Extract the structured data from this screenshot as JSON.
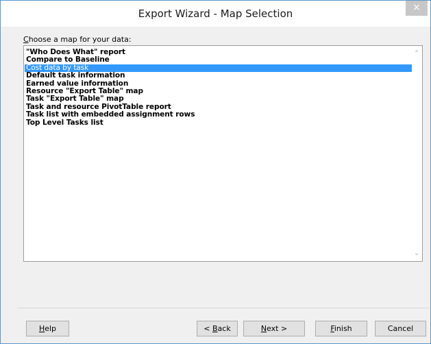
{
  "window": {
    "title": "Export Wizard - Map Selection",
    "close_glyph": "×"
  },
  "prompt": {
    "accesskey": "C",
    "rest": "hoose a map for your data:"
  },
  "maps": [
    {
      "label": "\"Who Does What\" report",
      "selected": false
    },
    {
      "label": "Compare to Baseline",
      "selected": false
    },
    {
      "label": "Cost data by task",
      "selected": true
    },
    {
      "label": "Default task information",
      "selected": false
    },
    {
      "label": "Earned value information",
      "selected": false
    },
    {
      "label": "Resource \"Export Table\" map",
      "selected": false
    },
    {
      "label": "Task \"Export Table\" map",
      "selected": false
    },
    {
      "label": "Task and resource PivotTable report",
      "selected": false
    },
    {
      "label": "Task list with embedded assignment rows",
      "selected": false
    },
    {
      "label": "Top Level Tasks list",
      "selected": false
    }
  ],
  "scrollbar": {
    "up_glyph": "⌃",
    "down_glyph": "⌄"
  },
  "buttons": {
    "help": {
      "accesskey": "H",
      "rest": "elp"
    },
    "back": {
      "prefix": "< ",
      "accesskey": "B",
      "rest": "ack"
    },
    "next": {
      "accesskey": "N",
      "rest": "ext >"
    },
    "finish": {
      "accesskey": "F",
      "rest": "inish"
    },
    "cancel": {
      "label": "Cancel"
    }
  },
  "colors": {
    "selection": "#3399ff",
    "window_border": "#5a96c8",
    "close_button": "#c7c7c7"
  }
}
